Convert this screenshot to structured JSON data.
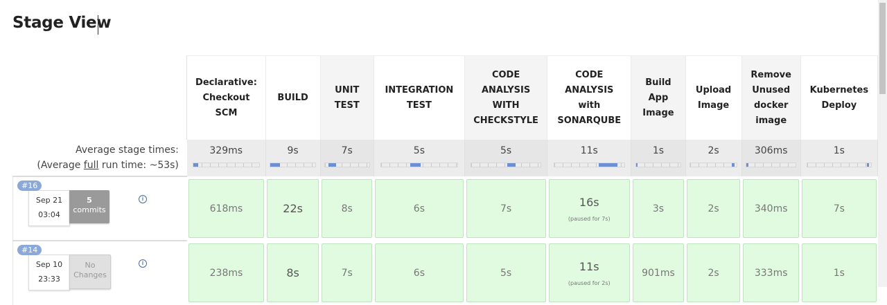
{
  "page": {
    "title": "Stage View"
  },
  "stages": [
    {
      "name": "Declarative: Checkout SCM",
      "lines": [
        "Declarative:",
        "Checkout",
        "SCM"
      ],
      "avg": "329ms",
      "avg_fraction": 0.08
    },
    {
      "name": "BUILD",
      "lines": [
        "BUILD"
      ],
      "avg": "9s",
      "avg_fraction": 0.22
    },
    {
      "name": "UNIT TEST",
      "lines": [
        "UNIT",
        "TEST"
      ],
      "avg": "7s",
      "avg_fraction": 0.17
    },
    {
      "name": "INTEGRATION TEST",
      "lines": [
        "INTEGRATION",
        "TEST"
      ],
      "avg": "5s",
      "avg_fraction": 0.14
    },
    {
      "name": "CODE ANALYSIS WITH CHECKSTYLE",
      "lines": [
        "CODE",
        "ANALYSIS",
        "WITH",
        "CHECKSTYLE"
      ],
      "avg": "5s",
      "avg_fraction": 0.12
    },
    {
      "name": "CODE ANALYSIS with SONARQUBE",
      "lines": [
        "CODE",
        "ANALYSIS",
        "with",
        "SONARQUBE"
      ],
      "avg": "11s",
      "avg_fraction": 0.26
    },
    {
      "name": "Build App Image",
      "lines": [
        "Build",
        "App",
        "Image"
      ],
      "avg": "1s",
      "avg_fraction": 0.04
    },
    {
      "name": "Upload Image",
      "lines": [
        "Upload",
        "Image"
      ],
      "avg": "2s",
      "avg_fraction": 0.05
    },
    {
      "name": "Remove Unused docker image",
      "lines": [
        "Remove",
        "Unused",
        "docker",
        "image"
      ],
      "avg": "306ms",
      "avg_fraction": 0.03
    },
    {
      "name": "Kubernetes Deploy",
      "lines": [
        "Kubernetes",
        "Deploy"
      ],
      "avg": "1s",
      "avg_fraction": 0.04
    }
  ],
  "average": {
    "label": "Average stage times:",
    "full_prefix": "(Average ",
    "full_word": "full",
    "full_suffix": " run time: ~53s)"
  },
  "runs": [
    {
      "number": "#16",
      "date": "Sep 21",
      "time": "03:04",
      "changes_count": "5",
      "changes_label": "commits",
      "has_changes": true,
      "durations": [
        {
          "value": "618ms"
        },
        {
          "value": "22s"
        },
        {
          "value": "8s"
        },
        {
          "value": "6s"
        },
        {
          "value": "7s"
        },
        {
          "value": "16s",
          "paused": "(paused for 7s)"
        },
        {
          "value": "3s"
        },
        {
          "value": "2s"
        },
        {
          "value": "340ms"
        },
        {
          "value": "7s"
        }
      ]
    },
    {
      "number": "#14",
      "date": "Sep 10",
      "time": "23:33",
      "changes_count": "No",
      "changes_label": "Changes",
      "has_changes": false,
      "durations": [
        {
          "value": "238ms"
        },
        {
          "value": "8s"
        },
        {
          "value": "7s"
        },
        {
          "value": "6s"
        },
        {
          "value": "5s"
        },
        {
          "value": "11s",
          "paused": "(paused for 2s)"
        },
        {
          "value": "901ms"
        },
        {
          "value": "2s"
        },
        {
          "value": "333ms"
        },
        {
          "value": "1s"
        }
      ]
    }
  ]
}
